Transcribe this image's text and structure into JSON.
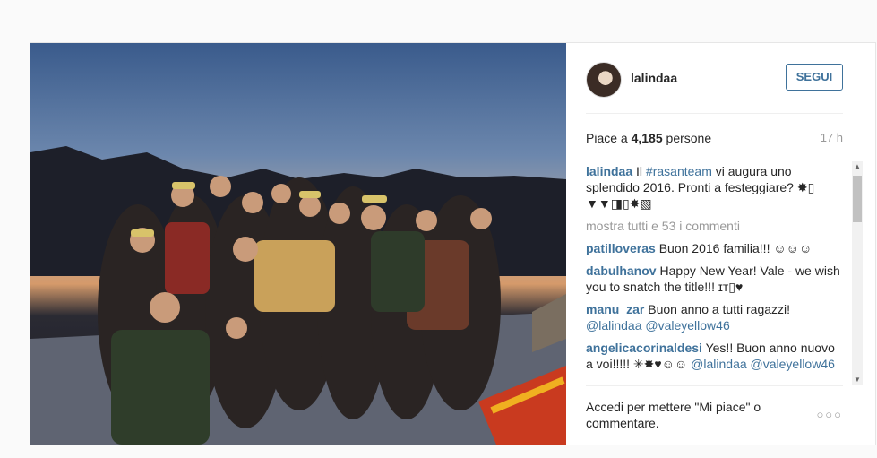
{
  "post": {
    "photo_alt": "",
    "header": {
      "username": "lalindaa",
      "follow_label": "SEGUI"
    },
    "likes": {
      "prefix": "Piace a ",
      "count": "4,185",
      "suffix": " persone"
    },
    "time": "17 h",
    "caption": {
      "user": "lalindaa",
      "text_before_tag": " Il ",
      "tag": "#rasanteam",
      "text_after_tag": " vi augura uno splendido 2016. Pronti a festeggiare? ✸▯ ▼▼◨▯✸▧"
    },
    "show_all": "mostra tutti e 53 i commenti",
    "comments": [
      {
        "user": "patilloveras",
        "text": " Buon 2016 familia!!! ☺☺☺"
      },
      {
        "user": "dabulhanov",
        "text": " Happy New Year! Vale - we wish you to snatch the title!!! ɪᴛ▯♥"
      },
      {
        "user": "manu_zar",
        "text": " Buon anno a tutti ragazzi! ",
        "mentions": "@lalindaa @valeyellow46"
      },
      {
        "user": "angelicacorinaldesi",
        "text": " Yes!! Buon anno nuovo a voi!!!!! ✳✸♥☺☺ ",
        "mentions": "@lalindaa @valeyellow46"
      }
    ],
    "footer": {
      "login_text": "Accedi per mettere \"Mi piace\" o commentare.",
      "more_dots": "○○○"
    },
    "scrollbar": {
      "up": "▲",
      "down": "▼"
    }
  }
}
